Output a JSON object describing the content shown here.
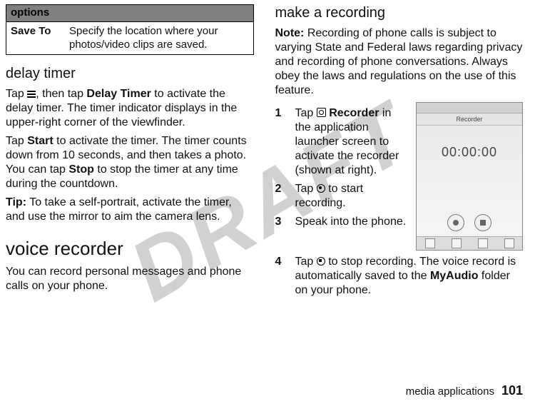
{
  "watermark": "DRAFT",
  "left": {
    "table": {
      "header": "options",
      "row_key": "Save To",
      "row_val": "Specify the location where your photos/video clips are saved."
    },
    "delay": {
      "heading": "delay timer",
      "p1a": "Tap ",
      "p1b": ", then tap ",
      "p1_bold1": "Delay Timer",
      "p1c": " to activate the delay timer. The timer indicator displays in the upper-right corner of the viewfinder.",
      "p2a": "Tap ",
      "p2_bold1": "Start",
      "p2b": " to activate the timer. The timer counts down from 10 seconds, and then takes a photo. You can tap ",
      "p2_bold2": "Stop",
      "p2c": " to stop the timer at any time during the countdown.",
      "tip_label": "Tip:",
      "tip_text": " To take a self-portrait, activate the timer, and use the mirror to aim the camera lens."
    },
    "voice": {
      "heading": "voice recorder",
      "p1": "You can record personal messages and phone calls on your phone."
    }
  },
  "right": {
    "make": {
      "heading": "make a recording",
      "note_label": "Note:",
      "note_text": " Recording of phone calls is subject to varying State and Federal laws regarding privacy and recording of phone conversations. Always obey the laws and regulations on the use of this feature.",
      "steps": {
        "s1a": "Tap ",
        "s1_bold": "Recorder",
        "s1b": " in the application launcher screen to activate the recorder (shown at right).",
        "s2a": "Tap ",
        "s2b": " to start recording.",
        "s3": "Speak into the phone.",
        "s4a": "Tap ",
        "s4b": " to stop recording. The voice record is automatically saved to the ",
        "s4_bold": "MyAudio",
        "s4c": " folder on your phone."
      },
      "screenshot": {
        "title": "Recorder",
        "timer": "00:00:00"
      }
    }
  },
  "footer": {
    "label": "media applications",
    "page": "101"
  }
}
